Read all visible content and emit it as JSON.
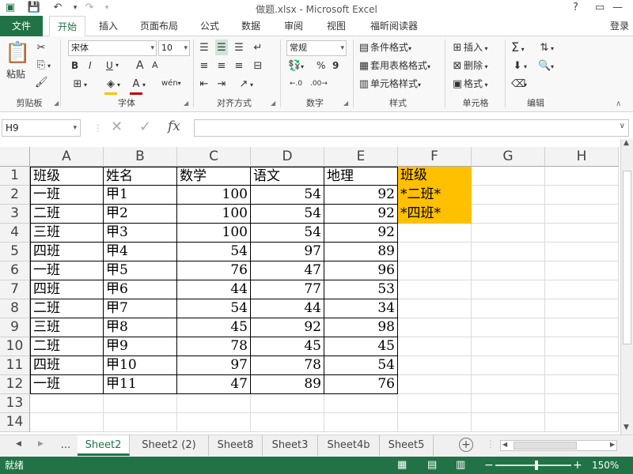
{
  "window": {
    "title": "做题.xlsx - Microsoft Excel",
    "controls": [
      "?",
      "▭",
      "—",
      "☐",
      "✕"
    ]
  },
  "qat": {
    "save_icon": "save-icon",
    "undo_icon": "undo-icon",
    "redo_icon": "redo-icon"
  },
  "account": {
    "login_label": "登录"
  },
  "ribbon_tabs": [
    "文件",
    "开始",
    "插入",
    "页面布局",
    "公式",
    "数据",
    "审阅",
    "视图",
    "福昕阅读器"
  ],
  "ribbon": {
    "clipboard": {
      "paste_label": "粘贴",
      "group_label": "剪贴板"
    },
    "font": {
      "font_name": "宋体",
      "font_size": "10",
      "bold": "B",
      "italic": "I",
      "underline": "U",
      "grow": "A",
      "shrink": "A",
      "group_label": "字体"
    },
    "alignment": {
      "group_label": "对齐方式"
    },
    "number": {
      "format": "常规",
      "percent": "%",
      "comma": "9",
      "group_label": "数字"
    },
    "styles": {
      "conditional": "条件格式",
      "table": "套用表格格式",
      "cell": "单元格样式",
      "group_label": "样式"
    },
    "cells": {
      "insert": "插入",
      "delete": "删除",
      "format": "格式",
      "group_label": "单元格"
    },
    "editing": {
      "group_label": "编辑"
    }
  },
  "formula_bar": {
    "name_box": "H9",
    "fx": "fx",
    "value": ""
  },
  "sheet": {
    "columns": [
      "A",
      "B",
      "C",
      "D",
      "E",
      "F",
      "G",
      "H"
    ],
    "rows": [
      "1",
      "2",
      "3",
      "4",
      "5",
      "6",
      "7",
      "8",
      "9",
      "10",
      "11",
      "12",
      "13",
      "14"
    ],
    "data": [
      [
        "班级",
        "姓名",
        "数学",
        "语文",
        "地理",
        "班级"
      ],
      [
        "一班",
        "甲1",
        "100",
        "54",
        "92",
        "*二班*"
      ],
      [
        "二班",
        "甲2",
        "100",
        "54",
        "92",
        "*四班*"
      ],
      [
        "三班",
        "甲3",
        "100",
        "54",
        "92",
        ""
      ],
      [
        "四班",
        "甲4",
        "54",
        "97",
        "89",
        ""
      ],
      [
        "一班",
        "甲5",
        "76",
        "47",
        "96",
        ""
      ],
      [
        "四班",
        "甲6",
        "44",
        "77",
        "53",
        ""
      ],
      [
        "二班",
        "甲7",
        "54",
        "44",
        "34",
        ""
      ],
      [
        "三班",
        "甲8",
        "45",
        "92",
        "98",
        ""
      ],
      [
        "二班",
        "甲9",
        "78",
        "45",
        "45",
        ""
      ],
      [
        "四班",
        "甲10",
        "97",
        "78",
        "54",
        ""
      ],
      [
        "一班",
        "甲11",
        "47",
        "89",
        "76",
        ""
      ],
      [
        "",
        "",
        "",
        "",
        "",
        ""
      ],
      [
        "",
        "",
        "",
        "",
        "",
        ""
      ]
    ],
    "highlight_color": "#ffc000"
  },
  "sheet_tabs": {
    "tabs": [
      "Sheet2",
      "Sheet2 (2)",
      "Sheet8",
      "Sheet3",
      "Sheet4b",
      "Sheet5"
    ],
    "active": "Sheet2",
    "ellipsis": "..."
  },
  "status": {
    "ready": "就绪",
    "zoom": "150%"
  },
  "colors": {
    "accent": "#217346"
  }
}
